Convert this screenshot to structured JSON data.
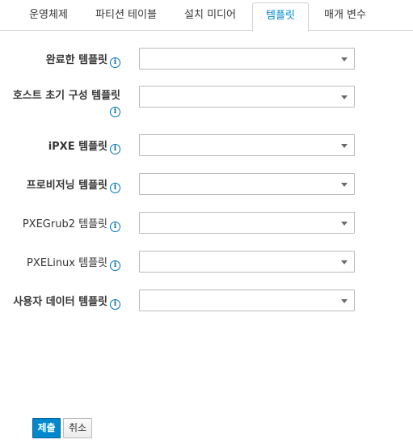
{
  "tabs": [
    {
      "label": "운영체제"
    },
    {
      "label": "파티션 테이블"
    },
    {
      "label": "설치 미디어"
    },
    {
      "label": "템플릿"
    },
    {
      "label": "매개 변수"
    }
  ],
  "active_tab": "템플릿",
  "fields": [
    {
      "label": "완료한 템플릿",
      "value": ""
    },
    {
      "label_line1": "호스트 초기 구성 템플릿",
      "value": ""
    },
    {
      "label": "iPXE 템플릿",
      "value": ""
    },
    {
      "label": "프로비저닝 템플릿",
      "value": ""
    },
    {
      "label": "PXEGrub2 템플릿",
      "value": ""
    },
    {
      "label": "PXELinux 템플릿",
      "value": ""
    },
    {
      "label": "사용자 데이터 템플릿",
      "value": ""
    }
  ],
  "info_glyph": "i",
  "buttons": {
    "submit": "제출",
    "cancel": "취소"
  },
  "colors": {
    "accent": "#0088ce",
    "info_icon": "#0072b1",
    "border": "#d1d1d1"
  }
}
